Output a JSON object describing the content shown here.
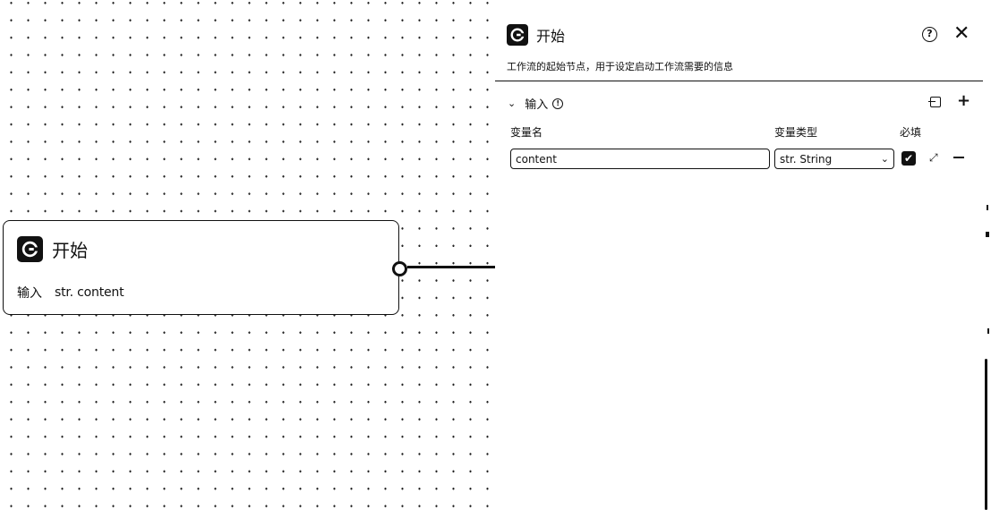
{
  "node": {
    "title": "开始",
    "io_label": "输入",
    "io_type": "str. content"
  },
  "panel": {
    "title": "开始",
    "help_glyph": "?",
    "close_glyph": "✕",
    "description": "工作流的起始节点，用于设定启动工作流需要的信息",
    "section": {
      "title": "输入",
      "chevron_glyph": "⌄",
      "info_glyph": "!",
      "add_glyph": "+"
    },
    "columns": {
      "name": "变量名",
      "type": "变量类型",
      "required": "必填"
    },
    "rows": [
      {
        "name": "content",
        "type": "str. String",
        "required": true
      }
    ],
    "caret_glyph": "⌄",
    "check_glyph": "✔",
    "expand_glyph": "⤢"
  },
  "icons": {
    "logo": "app-logo-icon",
    "help": "help-icon",
    "close": "close-icon",
    "import": "import-icon",
    "add": "add-icon",
    "expand": "expand-icon",
    "remove": "minus-icon",
    "info": "info-icon"
  }
}
